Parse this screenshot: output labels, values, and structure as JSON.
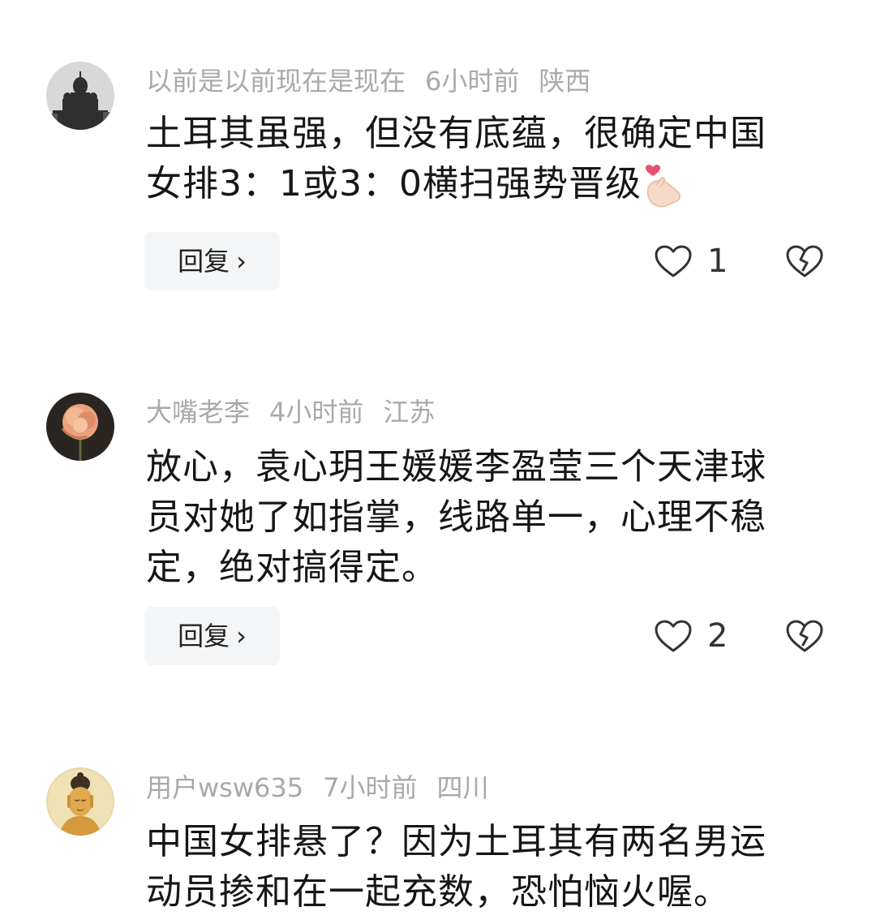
{
  "comments": [
    {
      "username": "以前是以前现在是现在",
      "time": "6小时前",
      "location": "陕西",
      "text_line1": "土耳其虽强，但没有底蕴，很确定中国",
      "text_line2": "女排3：1或3：0横扫强势晋级",
      "emoji": "finger-heart-emoji",
      "reply_label": "回复",
      "like_count": "1"
    },
    {
      "username": "大嘴老李",
      "time": "4小时前",
      "location": "江苏",
      "text_line1": "放心，袁心玥王媛媛李盈莹三个天津球",
      "text_line2": "员对她了如指掌，线路单一，心理不稳",
      "text_line3": "定，绝对搞得定。",
      "reply_label": "回复",
      "like_count": "2"
    },
    {
      "username": "用户wsw635",
      "time": "7小时前",
      "location": "四川",
      "text_line1": "中国女排悬了？因为土耳其有两名男运",
      "text_line2": "动员掺和在一起充数，恐怕恼火喔。"
    }
  ],
  "icons": {
    "like": "heart-outline-icon",
    "dislike": "broken-heart-icon",
    "chevron": "chevron-right-icon"
  },
  "colors": {
    "meta_text": "#a9a9a9",
    "body_text": "#161616",
    "reply_bg": "#f4f5f7",
    "icon_stroke": "#333333"
  }
}
